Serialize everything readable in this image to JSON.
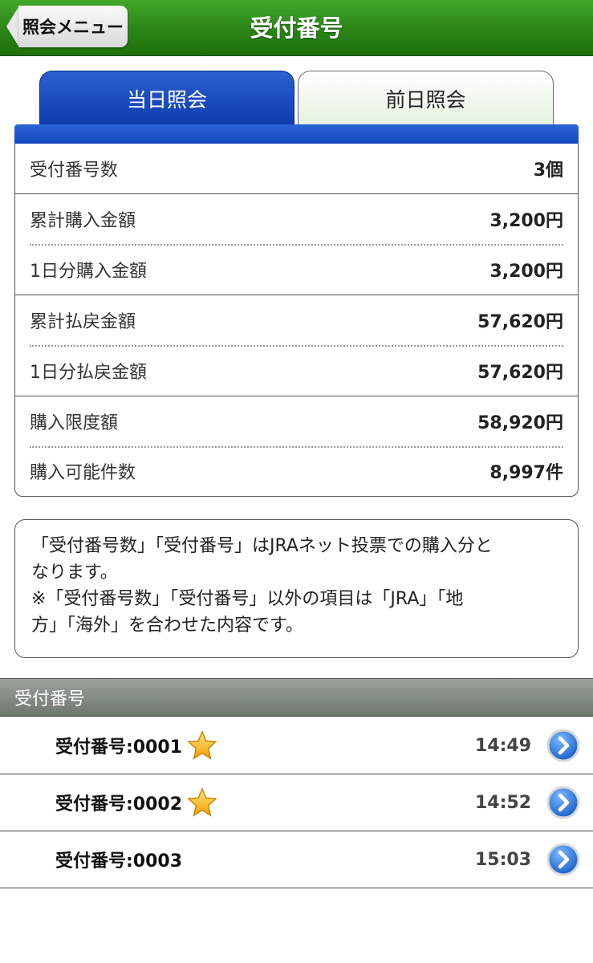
{
  "header": {
    "back_label": "照会メニュー",
    "title": "受付番号"
  },
  "tabs": [
    {
      "label": "当日照会",
      "active": true
    },
    {
      "label": "前日照会",
      "active": false
    }
  ],
  "summary": [
    {
      "label": "受付番号数",
      "value": "3個"
    },
    {
      "label": "累計購入金額",
      "value": "3,200円"
    },
    {
      "label": "1日分購入金額",
      "value": "3,200円"
    },
    {
      "label": "累計払戻金額",
      "value": "57,620円"
    },
    {
      "label": "1日分払戻金額",
      "value": "57,620円"
    },
    {
      "label": "購入限度額",
      "value": "58,920円"
    },
    {
      "label": "購入可能件数",
      "value": "8,997件"
    }
  ],
  "notice": {
    "line1": "「受付番号数」「受付番号」はJRAネット投票での購入分と",
    "line2": "なります。",
    "line3": "※「受付番号数」「受付番号」以外の項目は「JRA」「地",
    "line4": "方」「海外」を合わせた内容です。"
  },
  "list": {
    "section_title": "受付番号",
    "items": [
      {
        "label": "受付番号:0001",
        "time": "14:49",
        "starred": true
      },
      {
        "label": "受付番号:0002",
        "time": "14:52",
        "starred": true
      },
      {
        "label": "受付番号:0003",
        "time": "15:03",
        "starred": false
      }
    ]
  },
  "colors": {
    "header_green": "#2f8a1a",
    "tab_active_blue": "#1446c0",
    "star_gold": "#f5b400",
    "chevron_blue": "#1a6fd6"
  }
}
